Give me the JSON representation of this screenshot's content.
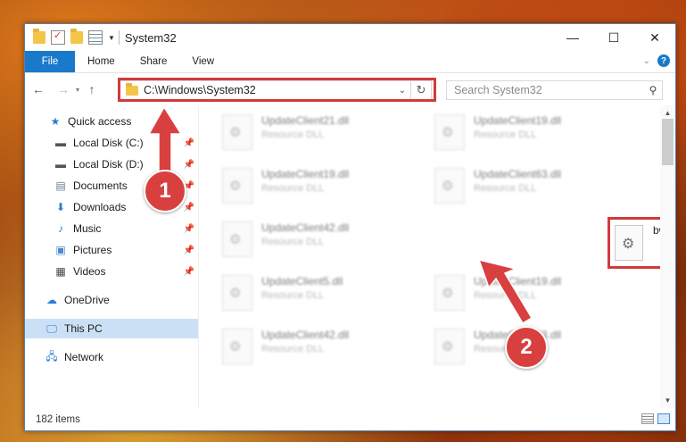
{
  "window": {
    "title": "System32",
    "buttons": {
      "minimize": "—",
      "maximize": "☐",
      "close": "✕"
    }
  },
  "ribbon": {
    "tabs": [
      "File",
      "Home",
      "Share",
      "View"
    ],
    "help": "?"
  },
  "address": {
    "path": "C:\\Windows\\System32",
    "search_placeholder": "Search System32"
  },
  "nav": {
    "quick_access": "Quick access",
    "items": [
      {
        "label": "Local Disk (C:)",
        "icon": "drive-icon",
        "pinned": true
      },
      {
        "label": "Local Disk (D:)",
        "icon": "drive-icon",
        "pinned": true
      },
      {
        "label": "Documents",
        "icon": "documents-icon",
        "pinned": true
      },
      {
        "label": "Downloads",
        "icon": "downloads-icon",
        "pinned": true
      },
      {
        "label": "Music",
        "icon": "music-icon",
        "pinned": true
      },
      {
        "label": "Pictures",
        "icon": "pictures-icon",
        "pinned": true
      },
      {
        "label": "Videos",
        "icon": "videos-icon",
        "pinned": true
      }
    ],
    "onedrive": "OneDrive",
    "this_pc": "This PC",
    "network": "Network"
  },
  "files": [
    {
      "name": "UpdateClient21.dll",
      "type": "Resource DLL"
    },
    {
      "name": "UpdateClient19.dll",
      "type": "Resource DLL"
    },
    {
      "name": "UpdateClient19.dll",
      "type": "Resource DLL"
    },
    {
      "name": "UpdateClient63.dll",
      "type": "Resource DLL"
    },
    {
      "name": "UpdateClient42.dll",
      "type": "Resource DLL"
    },
    {
      "name": "UpdateClient5.dll",
      "type": "Resource DLL"
    },
    {
      "name": "UpdateClient19.dll",
      "type": "Resource DLL"
    },
    {
      "name": "UpdateClient42.dll",
      "type": "Resource DLL"
    },
    {
      "name": "UpdateClient63.dll",
      "type": "Resource DLL"
    }
  ],
  "target_file": {
    "name": "bwdll.dll"
  },
  "status": {
    "count": "182 items"
  },
  "annotations": {
    "step1": "1",
    "step2": "2",
    "highlight_color": "#d13b3b"
  }
}
